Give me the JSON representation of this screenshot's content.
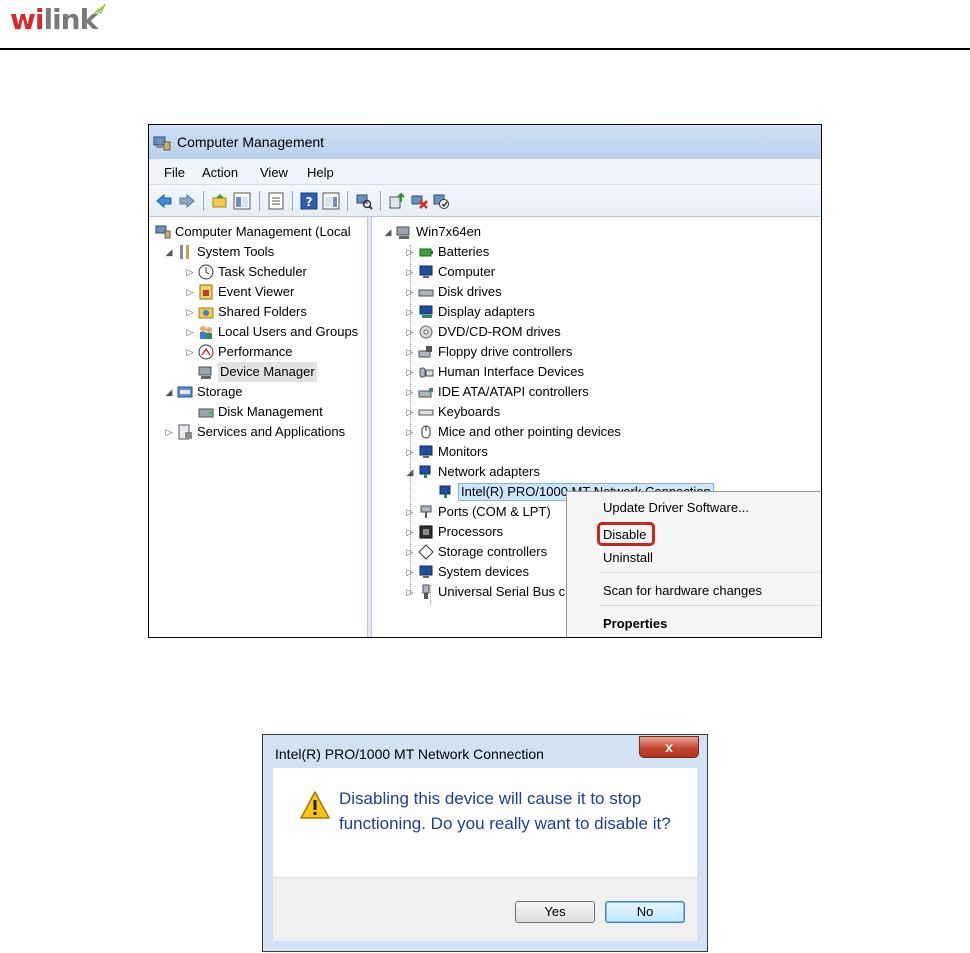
{
  "header": {
    "logo_w": "wi",
    "logo_rest": "link"
  },
  "window": {
    "title": "Computer Management",
    "menu": [
      "File",
      "Action",
      "View",
      "Help"
    ]
  },
  "left_tree": [
    {
      "label": "Computer Management (Local",
      "icon": "computer-management-icon"
    },
    {
      "label": "System Tools",
      "icon": "tools-icon"
    },
    {
      "label": "Task Scheduler",
      "icon": "clock-icon"
    },
    {
      "label": "Event Viewer",
      "icon": "event-viewer-icon"
    },
    {
      "label": "Shared Folders",
      "icon": "shared-folder-icon"
    },
    {
      "label": "Local Users and Groups",
      "icon": "users-icon"
    },
    {
      "label": "Performance",
      "icon": "performance-icon"
    },
    {
      "label": "Device Manager",
      "icon": "device-manager-icon"
    },
    {
      "label": "Storage",
      "icon": "storage-icon"
    },
    {
      "label": "Disk Management",
      "icon": "disk-management-icon"
    },
    {
      "label": "Services and Applications",
      "icon": "services-icon"
    }
  ],
  "right_tree": {
    "root": "Win7x64en",
    "items": [
      "Batteries",
      "Computer",
      "Disk drives",
      "Display adapters",
      "DVD/CD-ROM drives",
      "Floppy drive controllers",
      "Human Interface Devices",
      "IDE ATA/ATAPI controllers",
      "Keyboards",
      "Mice and other pointing devices",
      "Monitors",
      "Network adapters",
      "Intel(R) PRO/1000 MT Network Connection",
      "Ports (COM & LPT)",
      "Processors",
      "Storage controllers",
      "System devices",
      "Universal Serial Bus c"
    ]
  },
  "context_menu": {
    "update": "Update Driver Software...",
    "disable": "Disable",
    "uninstall": "Uninstall",
    "scan": "Scan for hardware changes",
    "properties": "Properties"
  },
  "dialog": {
    "title": "Intel(R) PRO/1000 MT Network Connection",
    "close": "x",
    "message": "Disabling this device will cause it to stop functioning. Do you really want to disable it?",
    "yes": "Yes",
    "no": "No"
  },
  "colors": {
    "logo_red": "#d8282c",
    "highlight_red": "#c9271d",
    "dialog_text": "#1c3f94",
    "dialog_frame": "#d3e2f2"
  }
}
